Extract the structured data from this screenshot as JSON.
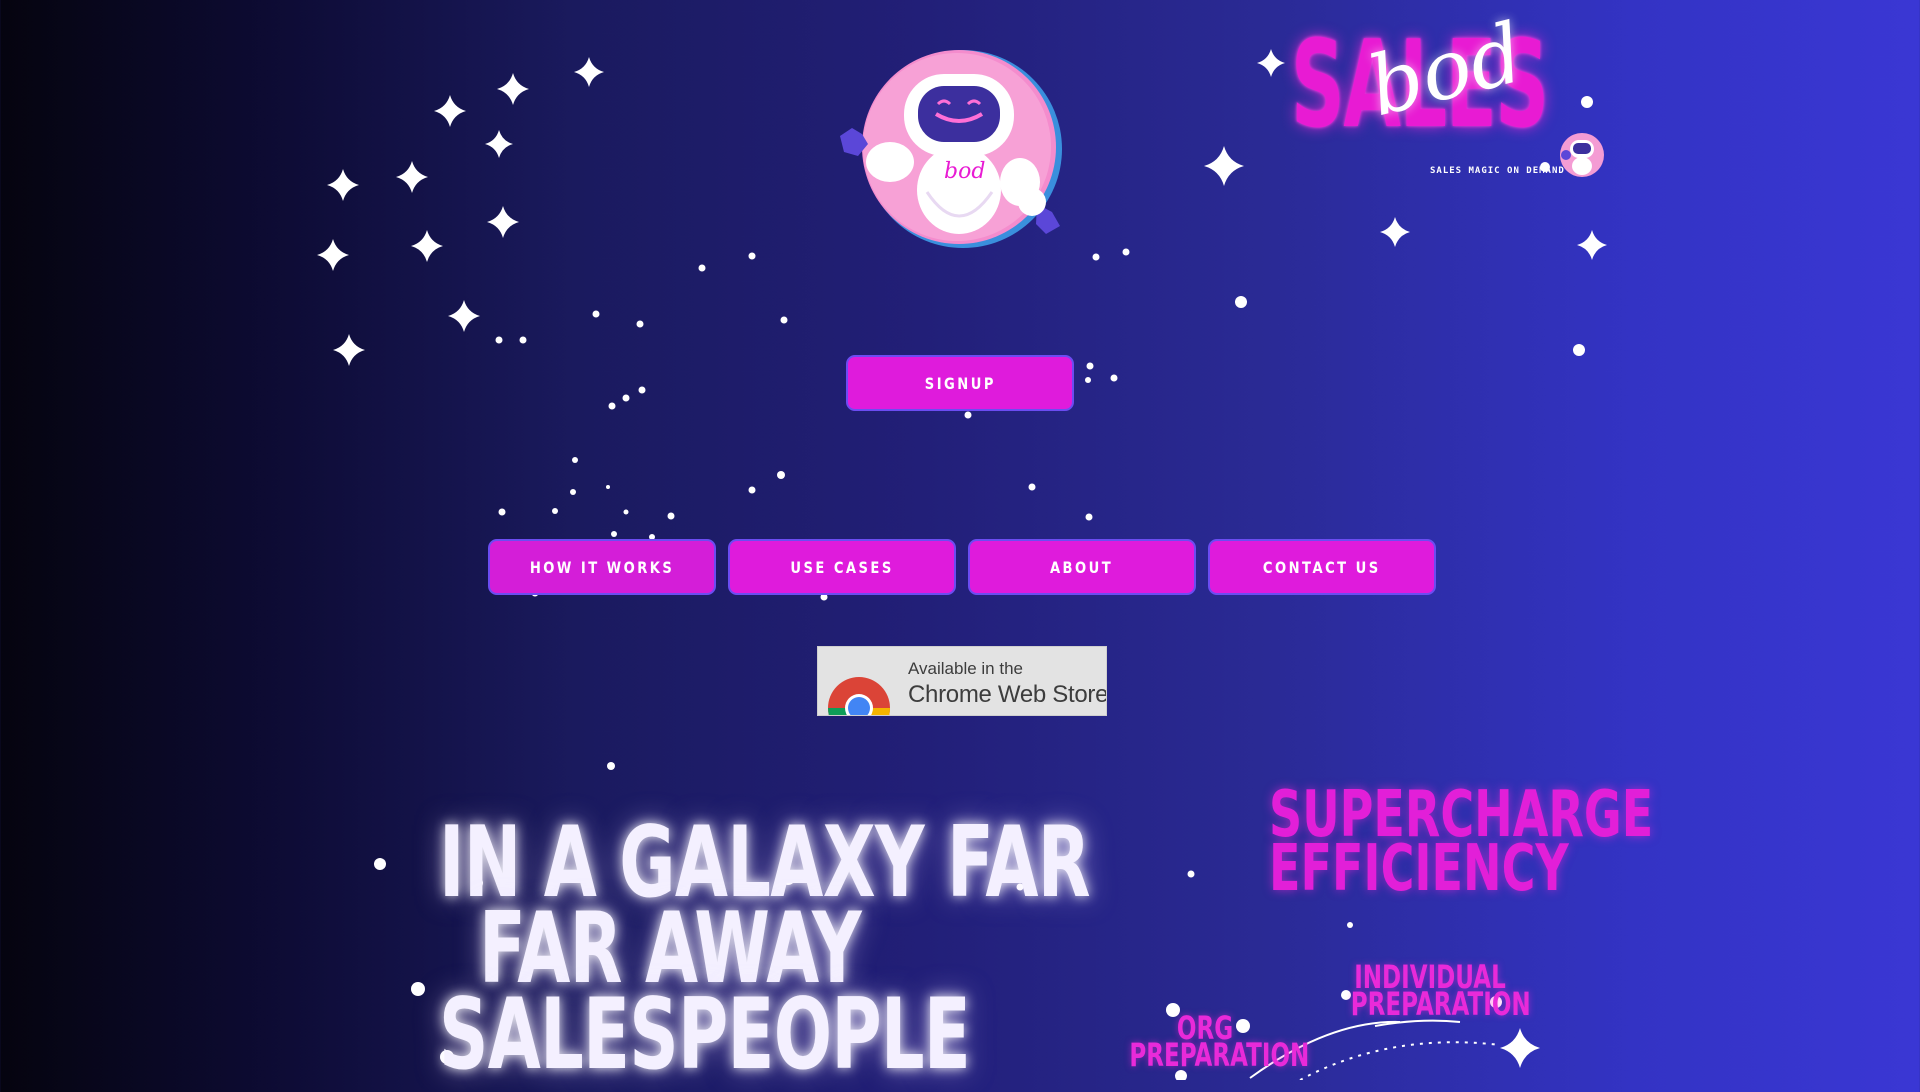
{
  "brand": {
    "wordmark": "SALES",
    "script": "bod",
    "tagline": "SALES MAGIC ON DEMAND"
  },
  "mascot": {
    "chest_text": "bod"
  },
  "signup": {
    "label": "SIGNUP"
  },
  "nav": {
    "items": [
      {
        "label": "HOW IT WORKS"
      },
      {
        "label": "USE CASES"
      },
      {
        "label": "ABOUT"
      },
      {
        "label": "CONTACT US"
      }
    ]
  },
  "chrome_store": {
    "line1": "Available in the",
    "line2": "Chrome Web Store"
  },
  "hero": {
    "lines": [
      "IN A GALAXY FAR",
      "FAR AWAY",
      "SALESPEOPLE"
    ]
  },
  "supercharge": {
    "lines": [
      "SUPERCHARGE",
      "EFFICIENCY"
    ]
  },
  "diagram": {
    "individual": [
      "INDIVIDUAL",
      "PREPARATION"
    ],
    "org": [
      "ORG",
      "PREPARATION"
    ]
  },
  "colors": {
    "button_fill": "#df1bdc",
    "button_border": "#6c4cf2",
    "accent_pink": "#e81bd3",
    "hero_text": "#f4f0ff"
  },
  "icons": {
    "stars": "sparkle-star-icon",
    "mascot": "robot-mascot-icon",
    "chrome": "chrome-logo-icon"
  }
}
